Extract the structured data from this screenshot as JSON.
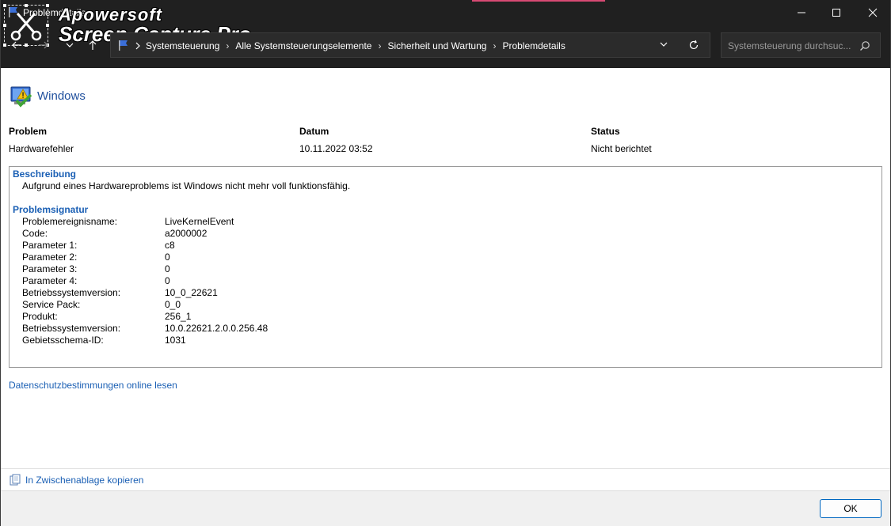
{
  "window": {
    "title": "Problemdetails",
    "controls": {
      "minimize_icon": "minimize-icon",
      "maximize_icon": "maximize-icon",
      "close_icon": "close-icon"
    }
  },
  "watermark": {
    "line1": "Apowersoft",
    "line2": "Screen Capture Pro"
  },
  "navigation": {
    "breadcrumbs": [
      "Systemsteuerung",
      "Alle Systemsteuerungselemente",
      "Sicherheit und Wartung",
      "Problemdetails"
    ],
    "search_placeholder": "Systemsteuerung durchsuc..."
  },
  "app": {
    "title": "Windows"
  },
  "summary": {
    "headers": {
      "problem": "Problem",
      "date": "Datum",
      "status": "Status"
    },
    "values": {
      "problem": "Hardwarefehler",
      "date": "10.11.2022 03:52",
      "status": "Nicht berichtet"
    }
  },
  "details": {
    "description_title": "Beschreibung",
    "description_text": "Aufgrund eines Hardwareproblems ist Windows nicht mehr voll funktionsfähig.",
    "signature_title": "Problemsignatur",
    "signature_rows": [
      {
        "key": "Problemereignisname:",
        "value": "LiveKernelEvent"
      },
      {
        "key": "Code:",
        "value": "a2000002"
      },
      {
        "key": "Parameter 1:",
        "value": "c8"
      },
      {
        "key": "Parameter 2:",
        "value": "0"
      },
      {
        "key": "Parameter 3:",
        "value": "0"
      },
      {
        "key": "Parameter 4:",
        "value": "0"
      },
      {
        "key": "Betriebssystemversion:",
        "value": "10_0_22621"
      },
      {
        "key": "Service Pack:",
        "value": "0_0"
      },
      {
        "key": "Produkt:",
        "value": "256_1"
      },
      {
        "key": "Betriebssystemversion:",
        "value": "10.0.22621.2.0.0.256.48"
      },
      {
        "key": "Gebietsschema-ID:",
        "value": "1031"
      }
    ]
  },
  "links": {
    "privacy": "Datenschutzbestimmungen online lesen",
    "copy": "In Zwischenablage kopieren"
  },
  "footer": {
    "ok_label": "OK"
  },
  "colors": {
    "titlebar": "#202020",
    "link": "#1a5fb4",
    "ok_border": "#0067c0"
  }
}
